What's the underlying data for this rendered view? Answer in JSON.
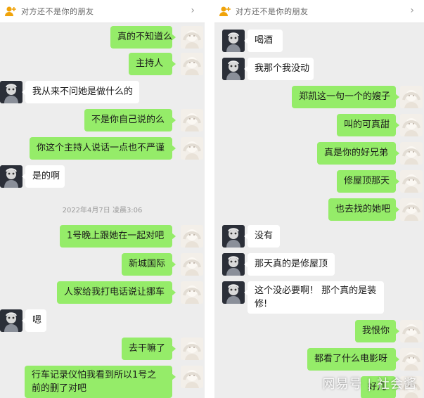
{
  "left": {
    "banner": "对方还不是你的朋友",
    "timestamp": "2022年4月7日 凌晨3:06",
    "messages": [
      {
        "side": "out",
        "text": "真的不知道么"
      },
      {
        "side": "out",
        "text": "主持人"
      },
      {
        "side": "in",
        "text": "我从来不问她是做什么的"
      },
      {
        "side": "out",
        "text": "不是你自己说的么"
      },
      {
        "side": "out",
        "text": "你这个主持人说话一点也不严谨"
      },
      {
        "side": "in",
        "text": "是的啊"
      },
      {
        "side": "out",
        "text": "1号晚上跟她在一起对吧"
      },
      {
        "side": "out",
        "text": "新城国际"
      },
      {
        "side": "out",
        "text": "人家给我打电话说让挪车"
      },
      {
        "side": "in",
        "text": "嗯"
      },
      {
        "side": "out",
        "text": "去干嘛了"
      },
      {
        "side": "out",
        "text": "行车记录仪怕我看到所以1号之前的删了对吧"
      }
    ]
  },
  "right": {
    "banner": "对方还不是你的朋友",
    "messages": [
      {
        "side": "in",
        "text": "喝酒"
      },
      {
        "side": "in",
        "text": "我那个我没动"
      },
      {
        "side": "out",
        "text": "郑凯这一句一个的嫂子"
      },
      {
        "side": "out",
        "text": "叫的可真甜"
      },
      {
        "side": "out",
        "text": "真是你的好兄弟"
      },
      {
        "side": "out",
        "text": "修屋顶那天"
      },
      {
        "side": "out",
        "text": "也去找的她吧"
      },
      {
        "side": "in",
        "text": "没有"
      },
      {
        "side": "in",
        "text": "那天真的是修屋顶"
      },
      {
        "side": "in",
        "text": "这个没必要啊！ 那个真的是装修!"
      },
      {
        "side": "out",
        "text": "我恨你"
      },
      {
        "side": "out",
        "text": "都看了什么电影呀"
      },
      {
        "side": "out",
        "text": "好几"
      }
    ]
  },
  "watermark": "网易号 | 社会酱",
  "colors": {
    "outgoing_bubble": "#95ec69",
    "incoming_bubble": "#ffffff",
    "chat_background": "#ededed"
  },
  "icons": {
    "banner": "person-add-icon",
    "chevron": "chevron-right-icon"
  }
}
